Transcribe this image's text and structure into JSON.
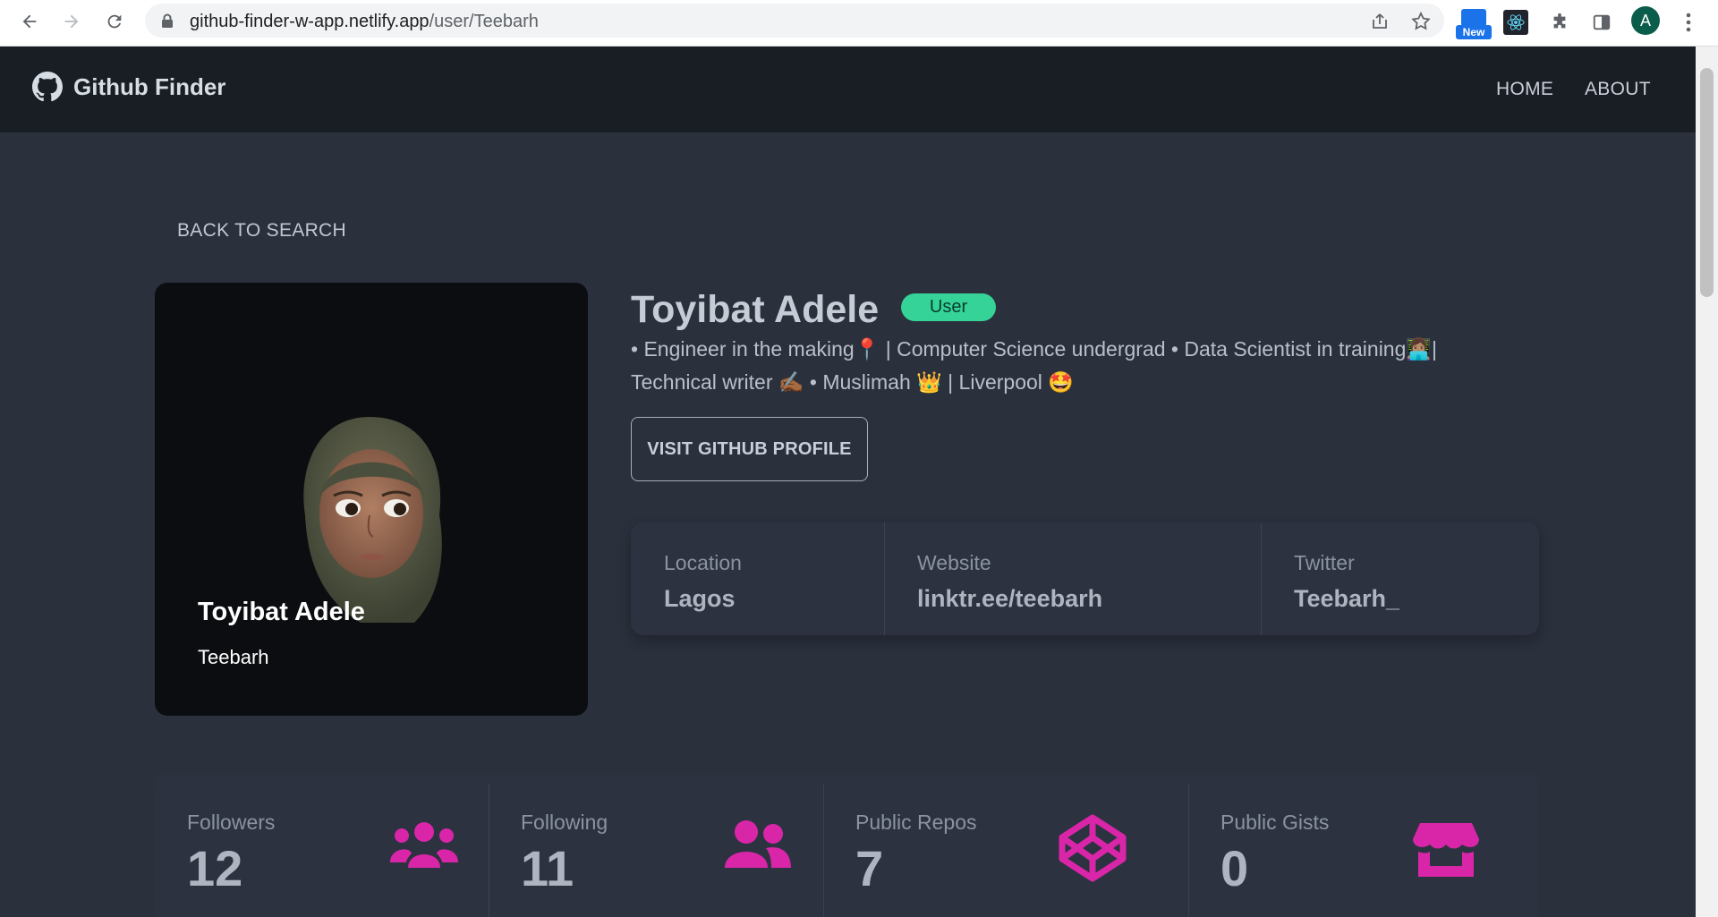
{
  "browser": {
    "url_host": "github-finder-w-app.netlify.app",
    "url_path": "/user/Teebarh",
    "new_badge": "New",
    "profile_initial": "A"
  },
  "navbar": {
    "brand": "Github Finder",
    "links": [
      "HOME",
      "ABOUT"
    ]
  },
  "back_label": "BACK TO SEARCH",
  "profile_card": {
    "name": "Toyibat Adele",
    "login": "Teebarh"
  },
  "profile": {
    "name": "Toyibat Adele",
    "type": "User",
    "bio": "• Engineer in the making📍 | Computer Science undergrad • Data Scientist in training👩🏽‍💻| Technical writer ✍🏾 • Muslimah 👑 | Liverpool 🤩",
    "visit_label": "VISIT GITHUB PROFILE"
  },
  "details": [
    {
      "title": "Location",
      "value": "Lagos"
    },
    {
      "title": "Website",
      "value": "linktr.ee/teebarh"
    },
    {
      "title": "Twitter",
      "value": "Teebarh_"
    }
  ],
  "stats": [
    {
      "title": "Followers",
      "value": "12",
      "icon": "users-group-icon"
    },
    {
      "title": "Following",
      "value": "11",
      "icon": "user-friends-icon"
    },
    {
      "title": "Public Repos",
      "value": "7",
      "icon": "codepen-icon"
    },
    {
      "title": "Public Gists",
      "value": "0",
      "icon": "store-icon"
    }
  ],
  "colors": {
    "accent_pink": "#d926a9",
    "badge_green": "#36d399",
    "nav_bg": "#191e24",
    "page_bg": "#2a303c"
  }
}
